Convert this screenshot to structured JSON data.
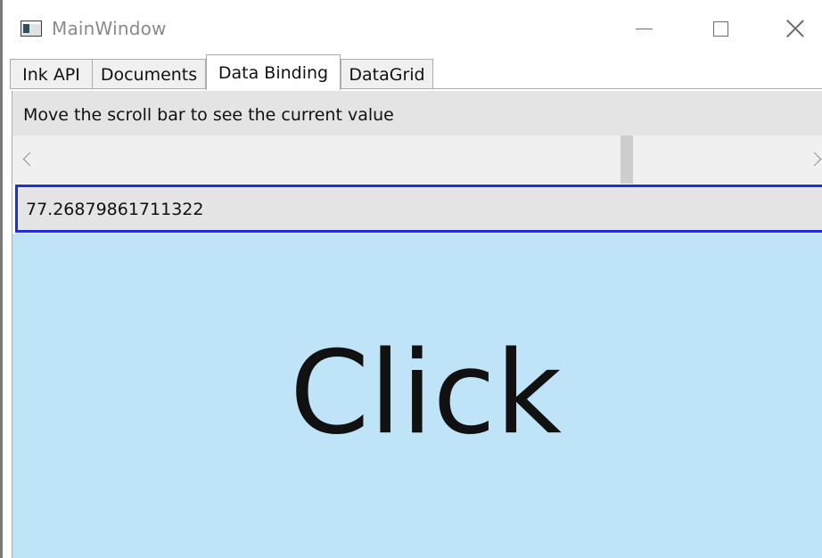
{
  "window": {
    "title": "MainWindow",
    "icon": "app-window-icon"
  },
  "controls": {
    "minimize_icon": "minimize-icon",
    "maximize_icon": "maximize-icon",
    "close_icon": "close-icon"
  },
  "tabs": [
    {
      "label": "Ink API",
      "selected": false
    },
    {
      "label": "Documents",
      "selected": false
    },
    {
      "label": "Data Binding",
      "selected": true
    },
    {
      "label": "DataGrid",
      "selected": false
    }
  ],
  "main": {
    "instruction": "Move the scroll bar to see the current value",
    "scroll_value": "77.26879861711322",
    "button_label": "Click"
  },
  "colors": {
    "value_box_border": "#1f2fd0",
    "button_background": "#bfe4f8",
    "label_background": "#e4e4e4"
  }
}
